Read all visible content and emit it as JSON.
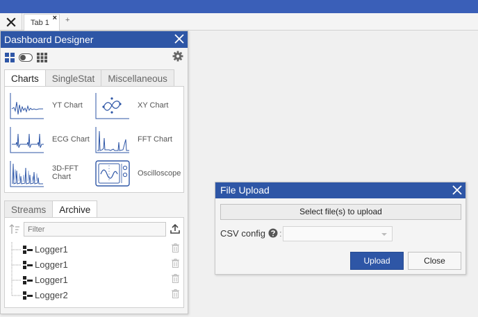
{
  "tabstrip": {
    "tabs": [
      {
        "label": "Tab 1",
        "close_glyph": "×"
      }
    ],
    "add_glyph": "+"
  },
  "designer": {
    "title": "Dashboard Designer",
    "tabs": [
      "Charts",
      "SingleStat",
      "Miscellaneous"
    ],
    "active_tab": "Charts",
    "charts": [
      {
        "label": "YT Chart",
        "icon": "yt-chart-icon"
      },
      {
        "label": "XY Chart",
        "icon": "xy-chart-icon"
      },
      {
        "label": "ECG Chart",
        "icon": "ecg-chart-icon"
      },
      {
        "label": "FFT Chart",
        "icon": "fft-chart-icon"
      },
      {
        "label": "3D-FFT Chart",
        "icon": "3d-fft-chart-icon"
      },
      {
        "label": "Oscilloscope",
        "icon": "oscilloscope-icon"
      }
    ],
    "lower_tabs": [
      "Streams",
      "Archive"
    ],
    "lower_active_tab": "Archive",
    "filter_placeholder": "Filter",
    "archive_items": [
      "Logger1",
      "Logger1",
      "Logger1",
      "Logger2"
    ]
  },
  "upload_dialog": {
    "title": "File Upload",
    "select_label": "Select file(s) to upload",
    "csv_label": "CSV config",
    "csv_value": "",
    "upload_label": "Upload",
    "close_label": "Close"
  },
  "colors": {
    "accent": "#2e56a6",
    "top_bar": "#3a5fb8"
  }
}
